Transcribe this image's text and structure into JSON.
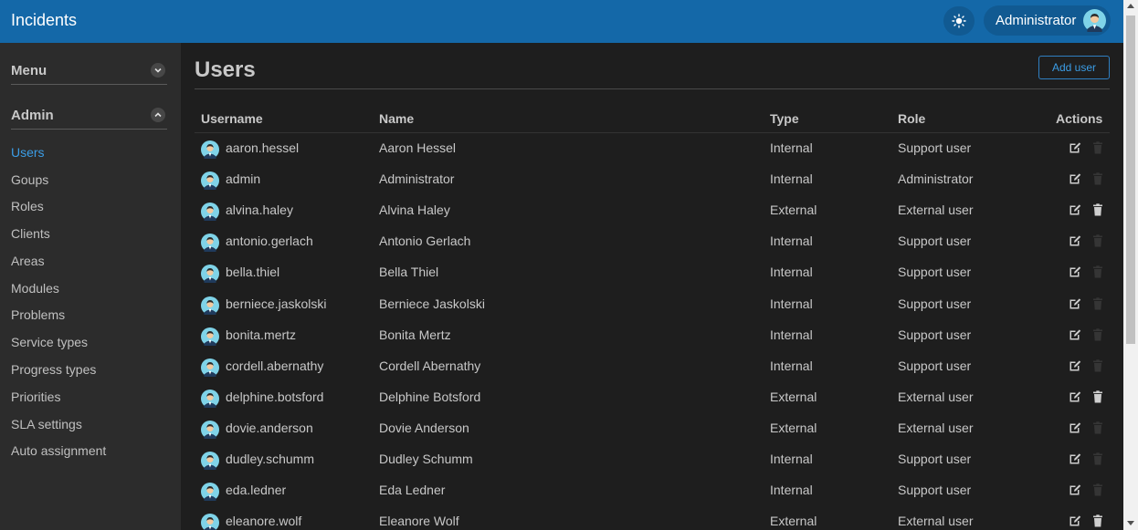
{
  "app": {
    "title": "Incidents",
    "theme_icon": "sun-icon",
    "user_name": "Administrator"
  },
  "sidebar": {
    "menu_label": "Menu",
    "admin_label": "Admin",
    "items": [
      {
        "label": "Users",
        "active": true
      },
      {
        "label": "Goups",
        "active": false
      },
      {
        "label": "Roles",
        "active": false
      },
      {
        "label": "Clients",
        "active": false
      },
      {
        "label": "Areas",
        "active": false
      },
      {
        "label": "Modules",
        "active": false
      },
      {
        "label": "Problems",
        "active": false
      },
      {
        "label": "Service types",
        "active": false
      },
      {
        "label": "Progress types",
        "active": false
      },
      {
        "label": "Priorities",
        "active": false
      },
      {
        "label": "SLA settings",
        "active": false
      },
      {
        "label": "Auto assignment",
        "active": false
      }
    ]
  },
  "main": {
    "title": "Users",
    "add_button": "Add user",
    "columns": {
      "username": "Username",
      "name": "Name",
      "type": "Type",
      "role": "Role",
      "actions": "Actions"
    },
    "rows": [
      {
        "username": "aaron.hessel",
        "name": "Aaron Hessel",
        "type": "Internal",
        "role": "Support user",
        "can_delete": false
      },
      {
        "username": "admin",
        "name": "Administrator",
        "type": "Internal",
        "role": "Administrator",
        "can_delete": false
      },
      {
        "username": "alvina.haley",
        "name": "Alvina Haley",
        "type": "External",
        "role": "External user",
        "can_delete": true
      },
      {
        "username": "antonio.gerlach",
        "name": "Antonio Gerlach",
        "type": "Internal",
        "role": "Support user",
        "can_delete": false
      },
      {
        "username": "bella.thiel",
        "name": "Bella Thiel",
        "type": "Internal",
        "role": "Support user",
        "can_delete": false
      },
      {
        "username": "berniece.jaskolski",
        "name": "Berniece Jaskolski",
        "type": "Internal",
        "role": "Support user",
        "can_delete": false
      },
      {
        "username": "bonita.mertz",
        "name": "Bonita Mertz",
        "type": "Internal",
        "role": "Support user",
        "can_delete": false
      },
      {
        "username": "cordell.abernathy",
        "name": "Cordell Abernathy",
        "type": "Internal",
        "role": "Support user",
        "can_delete": false
      },
      {
        "username": "delphine.botsford",
        "name": "Delphine Botsford",
        "type": "External",
        "role": "External user",
        "can_delete": true
      },
      {
        "username": "dovie.anderson",
        "name": "Dovie Anderson",
        "type": "External",
        "role": "External user",
        "can_delete": false
      },
      {
        "username": "dudley.schumm",
        "name": "Dudley Schumm",
        "type": "Internal",
        "role": "Support user",
        "can_delete": false
      },
      {
        "username": "eda.ledner",
        "name": "Eda Ledner",
        "type": "Internal",
        "role": "Support user",
        "can_delete": false
      },
      {
        "username": "eleanore.wolf",
        "name": "Eleanore Wolf",
        "type": "External",
        "role": "External user",
        "can_delete": true
      }
    ]
  },
  "colors": {
    "header": "#1468a8",
    "accent": "#3b9de6",
    "background": "#1e1e1e",
    "sidebar": "#2c2c2c"
  }
}
